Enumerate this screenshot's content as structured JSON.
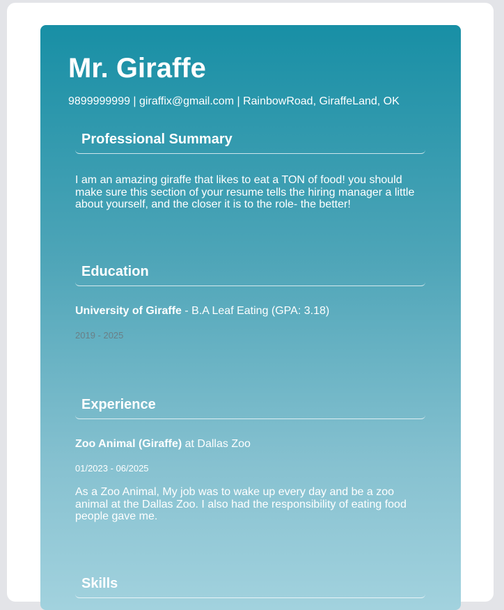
{
  "header": {
    "name": "Mr. Giraffe",
    "contact": "9899999999 | giraffix@gmail.com | RainbowRoad, GiraffeLand, OK"
  },
  "summary": {
    "title": "Professional Summary",
    "text": "I am an amazing giraffe that likes to eat a TON of food! you should make sure this section of your resume tells the hiring manager a little about yourself, and the closer it is to the role- the better!"
  },
  "education": {
    "title": "Education",
    "school": "University of Giraffe",
    "degree": " - B.A Leaf Eating (GPA: 3.18)",
    "dates": "2019 - 2025"
  },
  "experience": {
    "title": "Experience",
    "role": "Zoo Animal (Giraffe)",
    "company": " at Dallas Zoo",
    "dates": "01/2023 - 06/2025",
    "description": "As a Zoo Animal, My job was to wake up every day and be a zoo animal at the Dallas Zoo. I also had the responsibility of eating food people gave me."
  },
  "skills": {
    "title": "Skills"
  }
}
